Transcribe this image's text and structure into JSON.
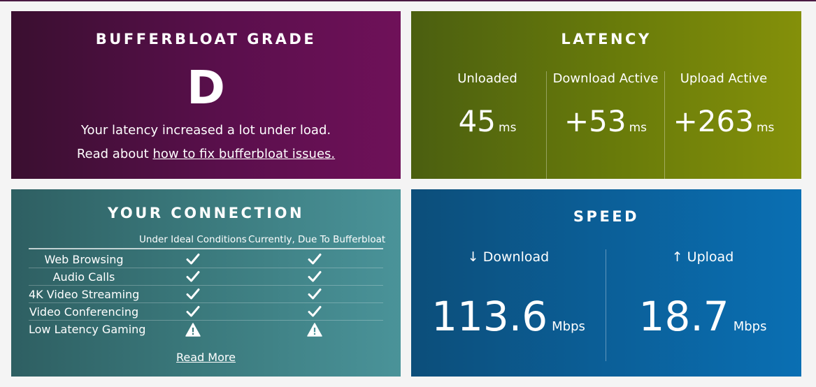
{
  "grade": {
    "title": "BUFFERBLOAT GRADE",
    "letter": "D",
    "message": "Your latency increased a lot under load.",
    "read_prefix": "Read about ",
    "read_link": "how to fix bufferbloat issues."
  },
  "latency": {
    "title": "LATENCY",
    "columns": [
      {
        "label": "Unloaded",
        "value": "45",
        "unit": "ms"
      },
      {
        "label": "Download Active",
        "value": "+53",
        "unit": "ms"
      },
      {
        "label": "Upload Active",
        "value": "+263",
        "unit": "ms"
      }
    ]
  },
  "connection": {
    "title": "YOUR CONNECTION",
    "col_ideal": "Under Ideal Conditions",
    "col_current": "Currently, Due To Bufferbloat",
    "rows": [
      {
        "label": "Web Browsing",
        "ideal": "check-icon",
        "current": "check-icon"
      },
      {
        "label": "Audio Calls",
        "ideal": "check-icon",
        "current": "check-icon"
      },
      {
        "label": "4K Video Streaming",
        "ideal": "check-icon",
        "current": "check-icon"
      },
      {
        "label": "Video Conferencing",
        "ideal": "check-icon",
        "current": "check-icon"
      },
      {
        "label": "Low Latency Gaming",
        "ideal": "warning-icon",
        "current": "warning-icon"
      }
    ],
    "read_more": "Read More"
  },
  "speed": {
    "title": "SPEED",
    "download_label": "↓ Download",
    "download_value": "113.6",
    "download_unit": "Mbps",
    "upload_label": "↑ Upload",
    "upload_value": "18.7",
    "upload_unit": "Mbps"
  }
}
